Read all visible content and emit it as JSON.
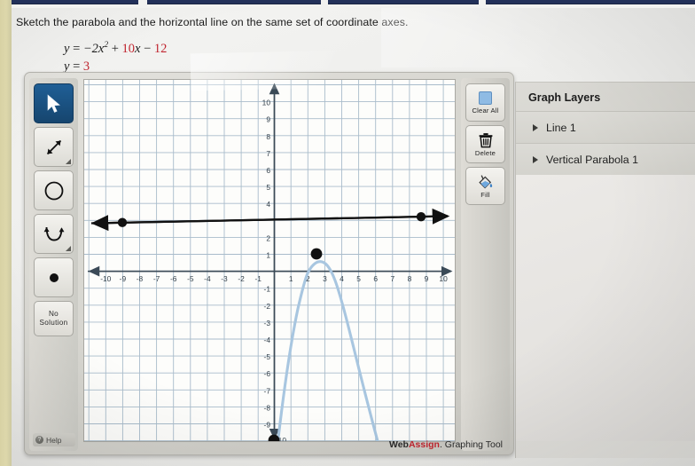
{
  "problem": {
    "prompt": "Sketch the parabola and the horizontal line on the same set of coordinate axes.",
    "equation_1": {
      "lhs": "y",
      "eq": " = ",
      "term_a": "−2x",
      "exponent": "2",
      "plus": " + ",
      "coef_b": "10",
      "var_b": "x",
      "minus": " − ",
      "const_c": "12"
    },
    "equation_2": {
      "lhs": "y",
      "eq": " = ",
      "value": "3"
    }
  },
  "tool": {
    "footer_brand_1": "Web",
    "footer_brand_2": "Assign",
    "footer_brand_3": ". Graphing Tool",
    "left_toolbar": {
      "items": [
        {
          "name": "select-tool",
          "label": "Select",
          "icon": "cursor-arrow-icon",
          "active": true
        },
        {
          "name": "line-tool",
          "label": "Line",
          "icon": "double-arrow-icon",
          "active": false
        },
        {
          "name": "circle-tool",
          "label": "Circle",
          "icon": "circle-icon",
          "active": false
        },
        {
          "name": "parabola-tool",
          "label": "Parabola",
          "icon": "parabola-icon",
          "active": false
        },
        {
          "name": "point-tool",
          "label": "Point",
          "icon": "filled-dot-icon",
          "active": false
        }
      ],
      "no_solution_line_1": "No",
      "no_solution_line_2": "Solution",
      "help_label": "Help",
      "help_glyph": "?"
    },
    "right_toolbar": {
      "clear_all_label": "Clear All",
      "delete_label": "Delete",
      "fill_label": "Fill"
    }
  },
  "layers": {
    "title": "Graph Layers",
    "items": [
      {
        "label": "Line 1"
      },
      {
        "label": "Vertical Parabola 1"
      }
    ]
  },
  "colors": {
    "accent_red": "#c0252f",
    "grid_line": "#9fb3c4",
    "axis": "#3b4a57",
    "curve_blue": "#a8c6e0",
    "object_black": "#111111",
    "tool_active": "#1f5f96"
  },
  "chart_data": {
    "type": "line",
    "title": "",
    "xlabel": "",
    "ylabel": "",
    "xlim": [
      -11,
      11
    ],
    "ylim": [
      -11,
      11
    ],
    "grid": true,
    "legend": "none",
    "x_ticks": [
      -10,
      -9,
      -8,
      -7,
      -6,
      -5,
      -4,
      -3,
      -2,
      -1,
      1,
      2,
      3,
      4,
      5,
      6,
      7,
      8,
      9,
      10
    ],
    "y_ticks": [
      10,
      9,
      8,
      7,
      6,
      5,
      4,
      2,
      1,
      -1,
      -2,
      -3,
      -4,
      -5,
      -6,
      -7,
      -8,
      -9,
      -10
    ],
    "series": [
      {
        "name": "Line 1",
        "kind": "horizontal-line",
        "equation": "y = 3",
        "color": "#111111",
        "y_value": 3,
        "arrows": "both",
        "control_points": [
          [
            -9,
            3
          ],
          [
            8.5,
            3
          ]
        ]
      },
      {
        "name": "Vertical Parabola 1",
        "kind": "parabola",
        "equation": "y = -2x^2 + 10x - 12",
        "color": "#a8c6e0",
        "vertex": [
          2.5,
          0.5
        ],
        "a": -2,
        "roots": [
          2,
          3
        ],
        "y_intercept": -12,
        "control_points": [
          [
            2.5,
            0.5
          ],
          [
            0,
            -10
          ]
        ],
        "points": [
          [
            0.2,
            -10.08
          ],
          [
            0.5,
            -7.5
          ],
          [
            1.0,
            -4.0
          ],
          [
            1.5,
            -1.5
          ],
          [
            2.0,
            0.0
          ],
          [
            2.5,
            0.5
          ],
          [
            3.0,
            0.0
          ],
          [
            3.5,
            -1.5
          ],
          [
            4.0,
            -4.0
          ],
          [
            4.5,
            -7.5
          ],
          [
            5.0,
            -12.0
          ]
        ]
      }
    ]
  }
}
